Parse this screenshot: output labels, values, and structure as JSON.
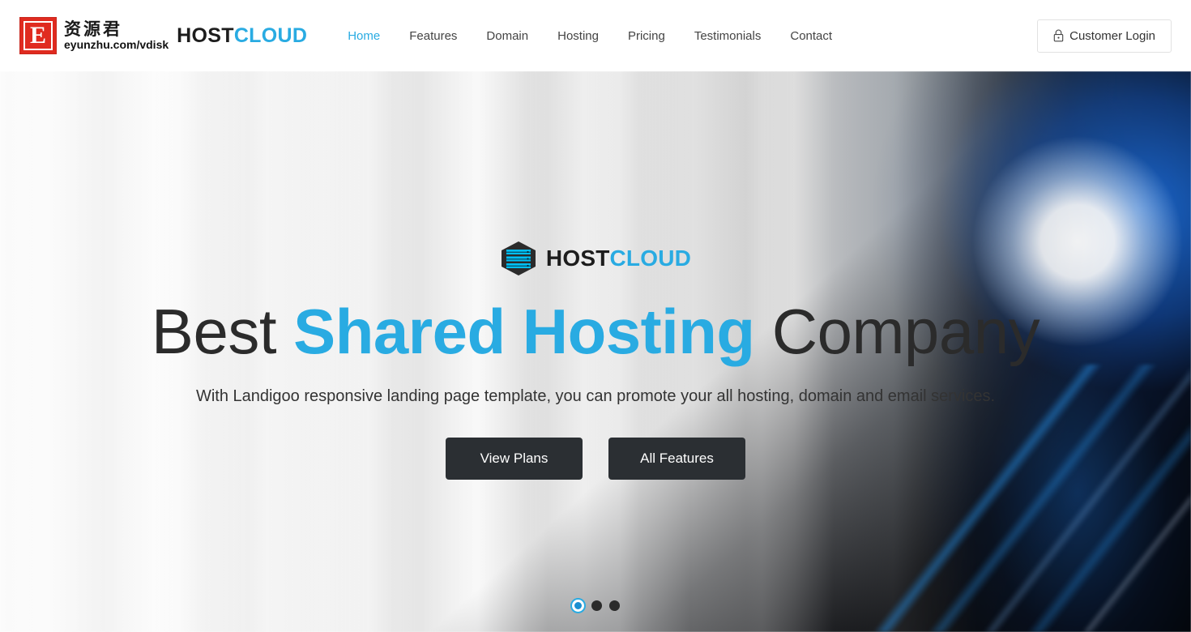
{
  "header": {
    "watermark": {
      "badge_letter": "E",
      "cn_name": "资源君",
      "url": "eyunzhu.com/vdisk"
    },
    "logo": {
      "part1": "HOST",
      "part2": "CLOUD"
    },
    "nav": [
      {
        "label": "Home",
        "active": true
      },
      {
        "label": "Features",
        "active": false
      },
      {
        "label": "Domain",
        "active": false
      },
      {
        "label": "Hosting",
        "active": false
      },
      {
        "label": "Pricing",
        "active": false
      },
      {
        "label": "Testimonials",
        "active": false
      },
      {
        "label": "Contact",
        "active": false
      }
    ],
    "login": {
      "label": "Customer Login",
      "icon": "lock-icon"
    }
  },
  "hero": {
    "logo": {
      "icon": "hexagon-server-icon",
      "part1": "HOST",
      "part2": "CLOUD"
    },
    "title": {
      "before": "Best ",
      "highlight": "Shared Hosting",
      "after": " Company"
    },
    "subtitle": "With Landigoo responsive landing page template, you can promote your all hosting, domain and email services.",
    "buttons": [
      {
        "label": "View Plans"
      },
      {
        "label": "All Features"
      }
    ],
    "carousel": {
      "slides": 3,
      "active_index": 0
    }
  },
  "colors": {
    "accent": "#29abe2",
    "dark": "#2b2f33",
    "text": "#333333",
    "watermark_red": "#e02b20"
  }
}
